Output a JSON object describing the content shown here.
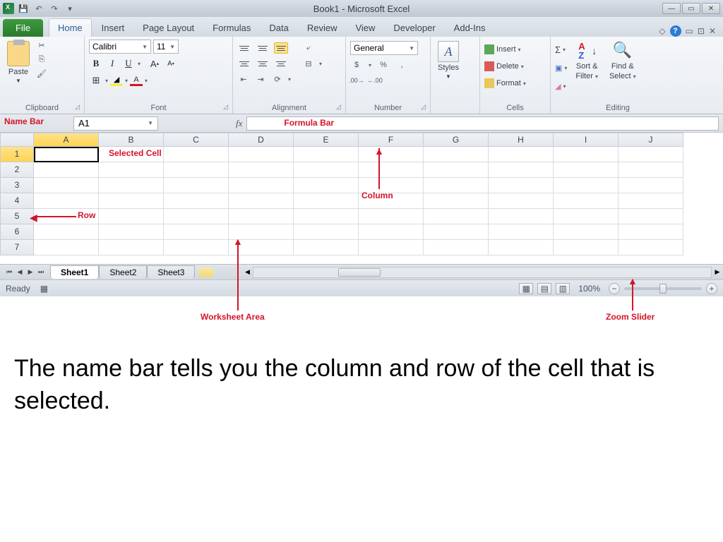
{
  "title": "Book1 - Microsoft Excel",
  "qat": {
    "save": "💾",
    "undo": "↶",
    "redo": "↷"
  },
  "tabs": {
    "file": "File",
    "items": [
      "Home",
      "Insert",
      "Page Layout",
      "Formulas",
      "Data",
      "Review",
      "View",
      "Developer",
      "Add-Ins"
    ]
  },
  "ribbon": {
    "clipboard": {
      "label": "Clipboard",
      "paste": "Paste"
    },
    "font": {
      "label": "Font",
      "name": "Calibri",
      "size": "11",
      "bold": "B",
      "italic": "I",
      "underline": "U"
    },
    "alignment": {
      "label": "Alignment"
    },
    "number": {
      "label": "Number",
      "format": "General",
      "percent": "%",
      "comma": ","
    },
    "styles": {
      "label": "Styles",
      "btn": "Styles"
    },
    "cells": {
      "label": "Cells",
      "insert": "Insert",
      "delete": "Delete",
      "format": "Format"
    },
    "editing": {
      "label": "Editing",
      "sigma": "Σ",
      "sort": "Sort &",
      "sort2": "Filter",
      "find": "Find &",
      "find2": "Select"
    }
  },
  "namebox": {
    "value": "A1"
  },
  "fx": "fx",
  "columns": [
    "A",
    "B",
    "C",
    "D",
    "E",
    "F",
    "G",
    "H",
    "I",
    "J"
  ],
  "rows": [
    "1",
    "2",
    "3",
    "4",
    "5",
    "6",
    "7"
  ],
  "sheets": {
    "active": "Sheet1",
    "s2": "Sheet2",
    "s3": "Sheet3"
  },
  "status": {
    "ready": "Ready",
    "zoom": "100%",
    "minus": "−",
    "plus": "+"
  },
  "annotations": {
    "namebar": "Name Bar",
    "formulabar": "Formula Bar",
    "selectedcell": "Selected Cell",
    "column": "Column",
    "row": "Row",
    "worksheet": "Worksheet Area",
    "zoomslider": "Zoom Slider"
  },
  "caption": "The name bar tells you the column and row of the cell that is selected."
}
